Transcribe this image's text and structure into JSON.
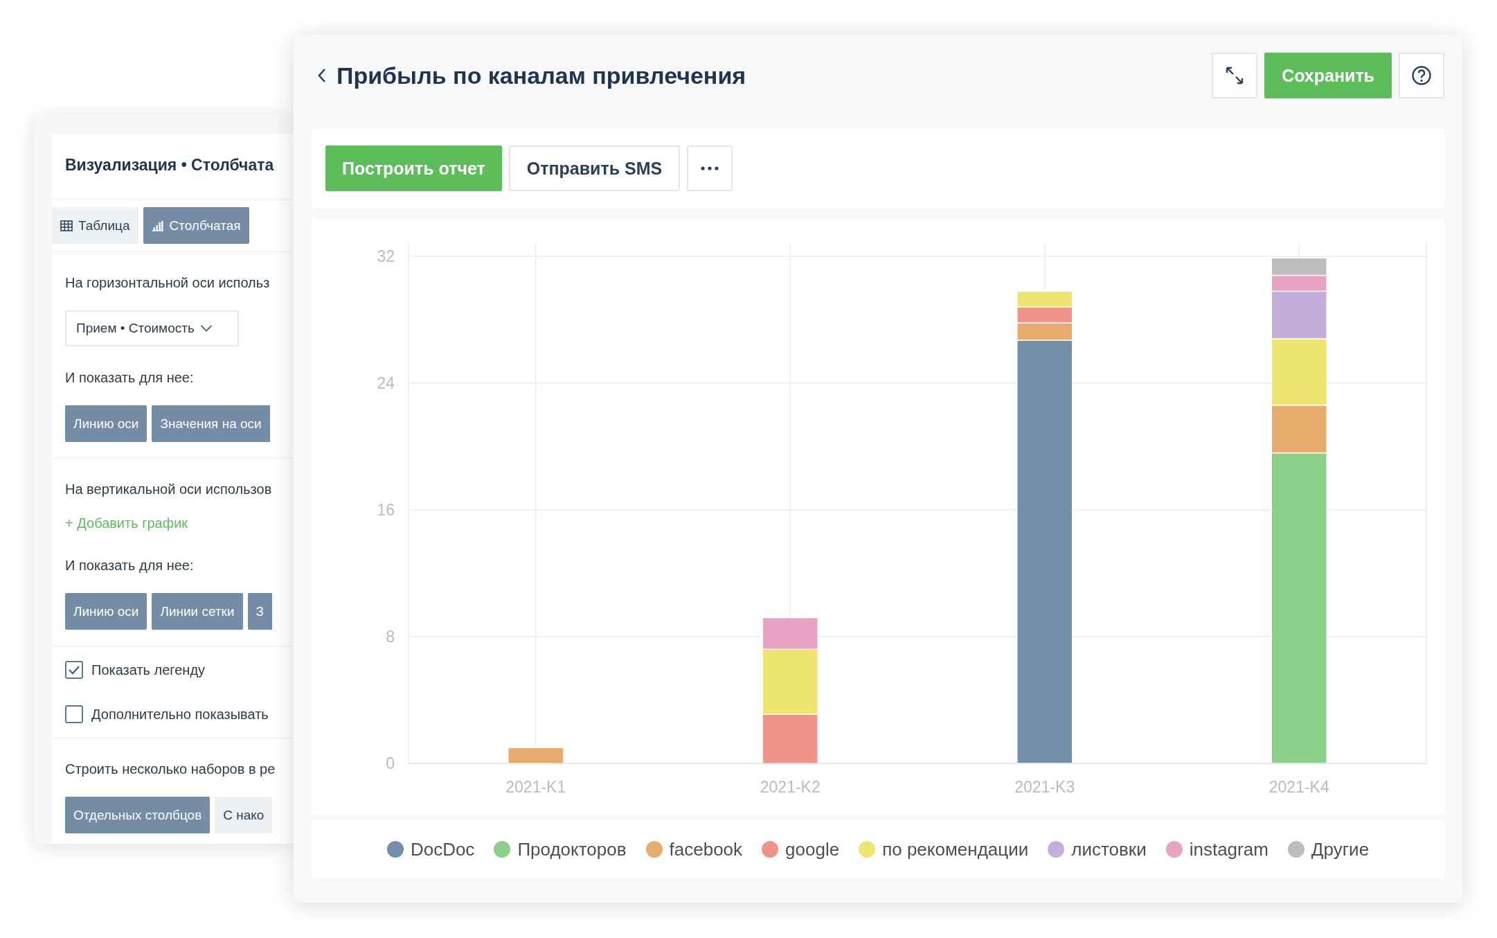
{
  "settings_panel": {
    "title": "Визуализация • Столбчата",
    "view_tabs": [
      {
        "label": "Таблица",
        "selected": false
      },
      {
        "label": "Столбчатая",
        "selected": true
      }
    ],
    "horizontal_axis": {
      "label": "На горизонтальной оси использ",
      "dropdown": {
        "value": "Прием • Стоимость"
      },
      "show_label": "И показать для нее:",
      "options": [
        {
          "label": "Линию оси",
          "selected": true
        },
        {
          "label": "Значения на оси",
          "selected": true
        }
      ]
    },
    "vertical_axis": {
      "label": "На вертикальной оси использов",
      "add_link": "+ Добавить график",
      "show_label": "И показать для нее:",
      "options": [
        {
          "label": "Линию оси",
          "selected": true
        },
        {
          "label": "Линии сетки",
          "selected": true
        },
        {
          "label": "З",
          "selected": true
        }
      ]
    },
    "checkboxes": [
      {
        "label": "Показать легенду",
        "checked": true
      },
      {
        "label": "Дополнительно показывать",
        "checked": false
      }
    ],
    "sets": {
      "label": "Строить несколько наборов в ре",
      "options": [
        {
          "label": "Отдельных столбцов",
          "selected": true
        },
        {
          "label": "С нако",
          "selected": false
        }
      ]
    }
  },
  "report": {
    "title": "Прибыль по каналам привлечения",
    "save_button": "Сохранить",
    "toolbar": [
      {
        "kind": "primary",
        "label": "Построить отчет"
      },
      {
        "kind": "secondary",
        "label": "Отправить SMS"
      },
      {
        "kind": "more"
      }
    ],
    "chart_data": {
      "type": "bar",
      "stacked": true,
      "grid": true,
      "categories": [
        "2021-K1",
        "2021-K2",
        "2021-K3",
        "2021-K4"
      ],
      "ylim": [
        0,
        32
      ],
      "yticks": [
        0,
        8,
        16,
        24,
        32
      ],
      "series": [
        {
          "name": "DocDoc",
          "color": "#748fa9",
          "values": [
            0,
            0,
            26.7,
            0
          ]
        },
        {
          "name": "Продокторов",
          "color": "#8bd18a",
          "values": [
            0,
            0,
            0,
            19.6
          ]
        },
        {
          "name": "facebook",
          "color": "#e8ab6e",
          "values": [
            1,
            0,
            1.1,
            3
          ]
        },
        {
          "name": "google",
          "color": "#f09489",
          "values": [
            0,
            3.1,
            1,
            0
          ]
        },
        {
          "name": "по рекомендации",
          "color": "#ede56f",
          "values": [
            0,
            4.1,
            1,
            4.2
          ]
        },
        {
          "name": "листовки",
          "color": "#c4afdc",
          "values": [
            0,
            0,
            0,
            3
          ]
        },
        {
          "name": "instagram",
          "color": "#e8a2c3",
          "values": [
            0,
            2,
            0,
            1
          ]
        },
        {
          "name": "Другие",
          "color": "#bdbdbd",
          "values": [
            0,
            0,
            0,
            1.1
          ]
        }
      ]
    }
  }
}
